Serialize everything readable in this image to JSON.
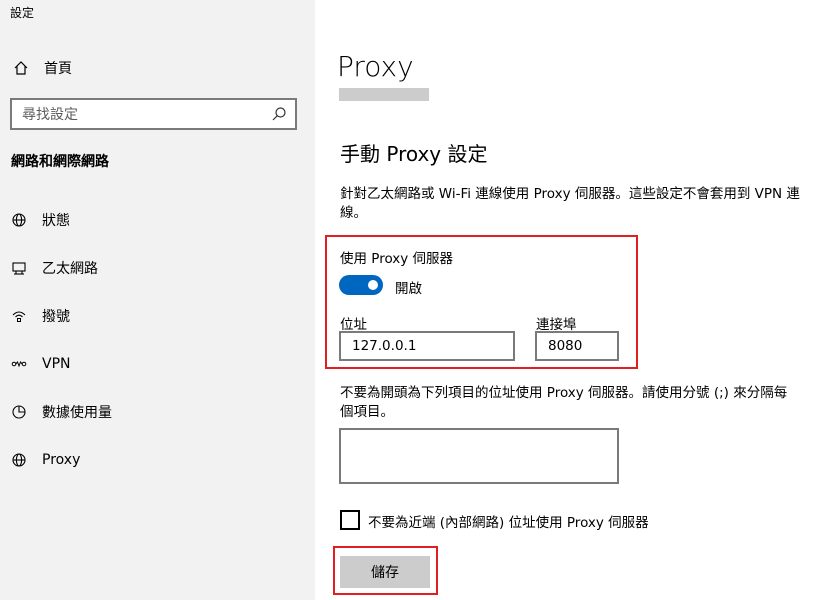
{
  "app": {
    "title": "設定"
  },
  "sidebar": {
    "home_label": "首頁",
    "search_placeholder": "尋找設定",
    "section_title": "網路和網際網路",
    "items": [
      {
        "label": "狀態",
        "icon": "globe-status-icon"
      },
      {
        "label": "乙太網路",
        "icon": "ethernet-icon"
      },
      {
        "label": "撥號",
        "icon": "dialup-icon"
      },
      {
        "label": "VPN",
        "icon": "vpn-icon"
      },
      {
        "label": "數據使用量",
        "icon": "data-usage-icon"
      },
      {
        "label": "Proxy",
        "icon": "globe-icon"
      }
    ]
  },
  "main": {
    "page_title": "Proxy",
    "manual_title": "手動 Proxy 設定",
    "description": "針對乙太網路或 Wi-Fi 連線使用 Proxy 伺服器。這些設定不會套用到 VPN 連線。",
    "use_proxy_label": "使用 Proxy 伺服器",
    "toggle_state_label": "開啟",
    "toggle_on": true,
    "address_label": "位址",
    "address_value": "127.0.0.1",
    "port_label": "連接埠",
    "port_value": "8080",
    "exceptions_description": "不要為開頭為下列項目的位址使用 Proxy 伺服器。請使用分號 (;) 來分隔每個項目。",
    "exceptions_value": "",
    "local_bypass_label": "不要為近端 (內部網路) 位址使用 Proxy 伺服器",
    "local_bypass_checked": false,
    "save_label": "儲存"
  },
  "colors": {
    "accent": "#0067c0",
    "highlight": "#e02020",
    "sidebar_bg": "#f2f2f2",
    "button_bg": "#cccccc"
  }
}
